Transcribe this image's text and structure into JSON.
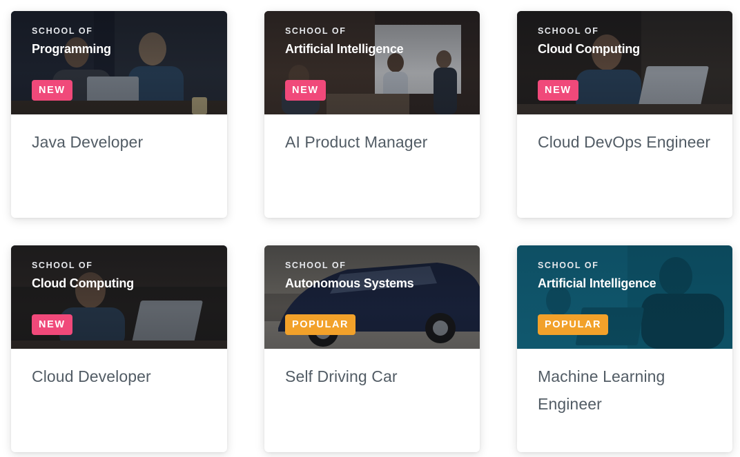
{
  "cards": [
    {
      "school_prefix": "SCHOOL OF",
      "school": "Programming",
      "badge": "NEW",
      "title": "Java Developer"
    },
    {
      "school_prefix": "SCHOOL OF",
      "school": "Artificial Intelligence",
      "badge": "NEW",
      "title": "AI Product Manager"
    },
    {
      "school_prefix": "SCHOOL OF",
      "school": "Cloud Computing",
      "badge": "NEW",
      "title": "Cloud DevOps Engineer"
    },
    {
      "school_prefix": "SCHOOL OF",
      "school": "Cloud Computing",
      "badge": "NEW",
      "title": "Cloud Developer"
    },
    {
      "school_prefix": "SCHOOL OF",
      "school": "Autonomous Systems",
      "badge": "POPULAR",
      "title": "Self Driving Car"
    },
    {
      "school_prefix": "SCHOOL OF",
      "school": "Artificial Intelligence",
      "badge": "POPULAR",
      "title": "Machine Learning Engineer"
    }
  ],
  "colors": {
    "badge_new": "#f0497a",
    "badge_popular": "#f2a12a",
    "title_text": "#525c65"
  }
}
